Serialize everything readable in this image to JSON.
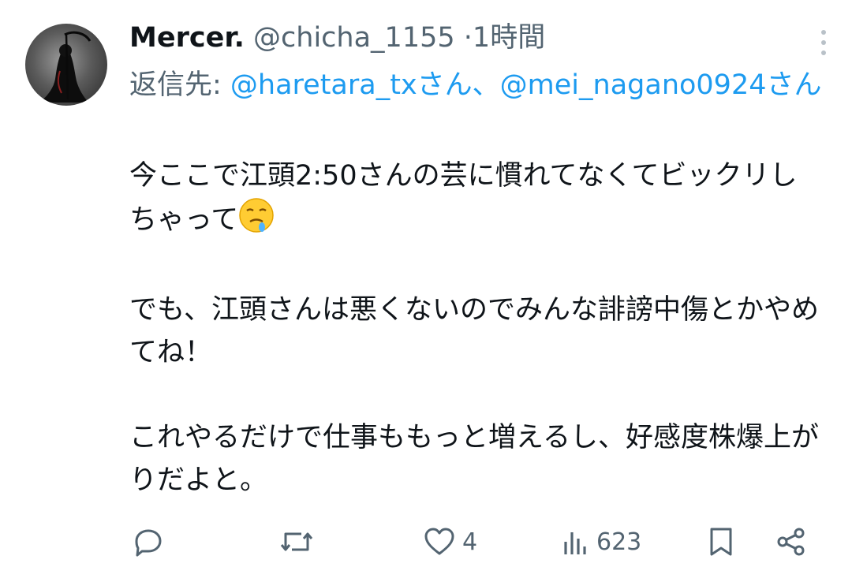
{
  "tweet": {
    "display_name": "Mercer.",
    "handle": "@chicha_1155",
    "separator": "·",
    "time": "1時間",
    "reply_prefix": "返信先: ",
    "reply_mention_1": "@haretara_txさん",
    "reply_sep": "、",
    "reply_mention_2": "@mei_nagano0924さん",
    "body_line_1": "今ここで江頭2:50さんの芸に慣れてなくてビックリしちゃって",
    "body_emoji": "face-holding-back-tears-emoji",
    "body_line_2": "でも、江頭さんは悪くないのでみんな誹謗中傷とかやめてね！",
    "body_line_3": "これやるだけで仕事ももっと増えるし、好感度株爆上がりだよと。"
  },
  "actions": {
    "reply_icon": "reply-icon",
    "retweet_icon": "retweet-icon",
    "like_icon": "heart-icon",
    "like_count": "4",
    "views_icon": "views-icon",
    "views_count": "623",
    "bookmark_icon": "bookmark-icon",
    "share_icon": "share-icon"
  },
  "colors": {
    "text": "#0f1419",
    "secondary": "#536471",
    "link": "#1d9bf0"
  }
}
